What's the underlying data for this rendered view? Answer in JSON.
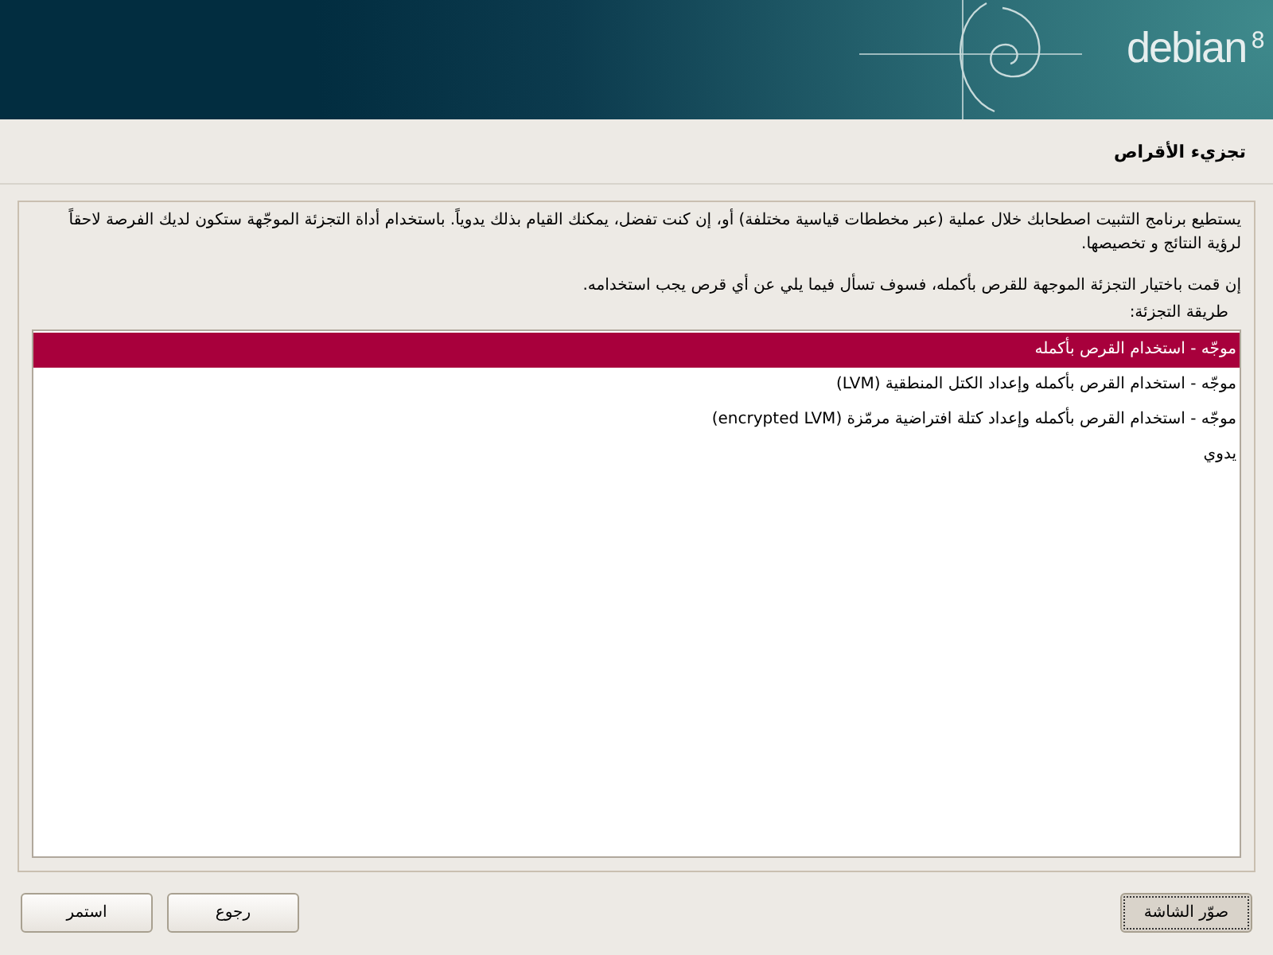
{
  "header": {
    "logo_text": "debian",
    "version": "8"
  },
  "title": "تجزيء الأقراص",
  "description": [
    "يستطيع برنامج التثبيت اصطحابك خلال عملية (عبر مخططات قياسية مختلفة) أو، إن كنت تفضل، يمكنك القيام بذلك يدوياً. باستخدام أداة التجزئة الموجّهة ستكون لديك الفرصة لاحقاً لرؤية النتائج و تخصيصها.",
    "إن قمت باختيار التجزئة الموجهة للقرص بأكمله، فسوف تسأل فيما يلي عن أي قرص يجب استخدامه."
  ],
  "list_label": "طريقة التجزئة:",
  "options": [
    {
      "label": "موجّه - استخدام القرص بأكمله",
      "selected": true
    },
    {
      "label": "موجّه - استخدام القرص بأكمله وإعداد الكتل المنطقية (LVM)",
      "selected": false
    },
    {
      "label": "موجّه - استخدام القرص بأكمله وإعداد كتلة افتراضية مرمّزة (encrypted LVM)",
      "selected": false
    },
    {
      "label": "يدوي",
      "selected": false
    }
  ],
  "buttons": [
    {
      "label": "صوّر الشاشة",
      "kind": "screenshot",
      "focused": true
    },
    {
      "label": "رجوع",
      "kind": "back",
      "focused": false
    },
    {
      "label": "استمر",
      "kind": "continue",
      "focused": false
    }
  ]
}
